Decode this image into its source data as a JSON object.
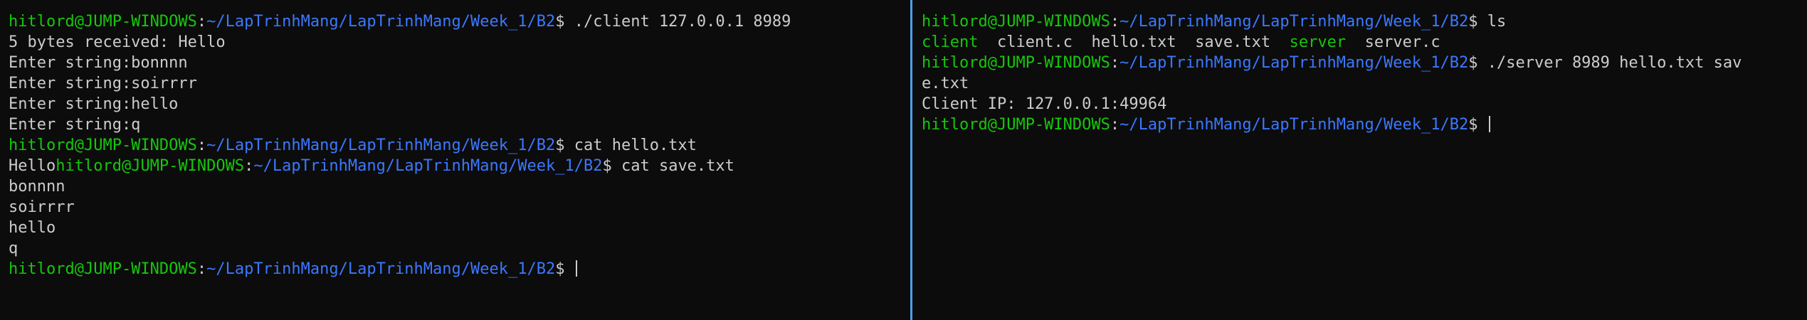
{
  "prompt": {
    "user_host": "hitlord@JUMP-WINDOWS",
    "sep": ":",
    "path": "~/LapTrinhMang/LapTrinhMang/Week_1/B2",
    "dollar": "$ "
  },
  "left_pane": {
    "cmd_client": "./client 127.0.0.1 8989",
    "out_received": "5 bytes received: Hello",
    "out_enter1": "Enter string:bonnnn",
    "out_enter2": "Enter string:soirrrr",
    "out_enter3": "Enter string:hello",
    "out_enter4": "Enter string:q",
    "cmd_cat_hello": "cat hello.txt",
    "out_hello": "Hello",
    "cmd_cat_save": "cat save.txt",
    "out_save1": "bonnnn",
    "out_save2": "soirrrr",
    "out_save3": "hello",
    "out_save4": "q"
  },
  "right_pane": {
    "cmd_ls": "ls",
    "ls_client": "client",
    "ls_client_c": "client.c",
    "ls_hello": "hello.txt",
    "ls_save": "save.txt",
    "ls_server": "server",
    "ls_server_c": "server.c",
    "cmd_server_part1": "./server 8989 hello.txt sav",
    "cmd_server_part2": "e.txt",
    "out_client_ip": "Client IP: 127.0.0.1:49964"
  },
  "colors": {
    "background": "#0c0c0c",
    "text": "#cccccc",
    "user_host": "#16c60c",
    "path": "#3b78ff",
    "executable": "#16c60c",
    "pane_divider": "#4aa3f0"
  }
}
